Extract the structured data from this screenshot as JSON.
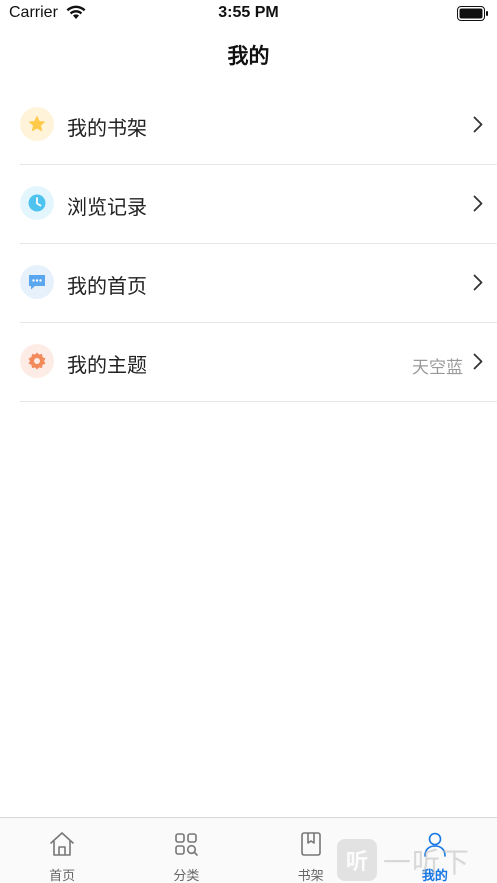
{
  "status_bar": {
    "carrier": "Carrier",
    "time": "3:55 PM"
  },
  "nav": {
    "title": "我的"
  },
  "menu": {
    "items": [
      {
        "label": "我的书架",
        "value": "",
        "icon": "star-icon",
        "icon_bg": "#fff4da",
        "icon_color": "#ffc94a"
      },
      {
        "label": "浏览记录",
        "value": "",
        "icon": "clock-icon",
        "icon_bg": "#e3f6fd",
        "icon_color": "#4fc3f0"
      },
      {
        "label": "我的首页",
        "value": "",
        "icon": "message-icon",
        "icon_bg": "#e6f1fc",
        "icon_color": "#5aa7f0"
      },
      {
        "label": "我的主题",
        "value": "天空蓝",
        "icon": "gear-icon",
        "icon_bg": "#fdece6",
        "icon_color": "#f28a5c"
      }
    ]
  },
  "tabs": [
    {
      "label": "首页",
      "icon": "home-icon",
      "active": false
    },
    {
      "label": "分类",
      "icon": "category-grid-icon",
      "active": false
    },
    {
      "label": "书架",
      "icon": "book-icon",
      "active": false
    },
    {
      "label": "我的",
      "icon": "user-icon",
      "active": true
    }
  ],
  "colors": {
    "accent": "#1677e5",
    "divider": "#e6e6e6",
    "secondary_text": "#9a9a9a"
  },
  "watermark": {
    "badge": "听",
    "text": "一听下载"
  }
}
